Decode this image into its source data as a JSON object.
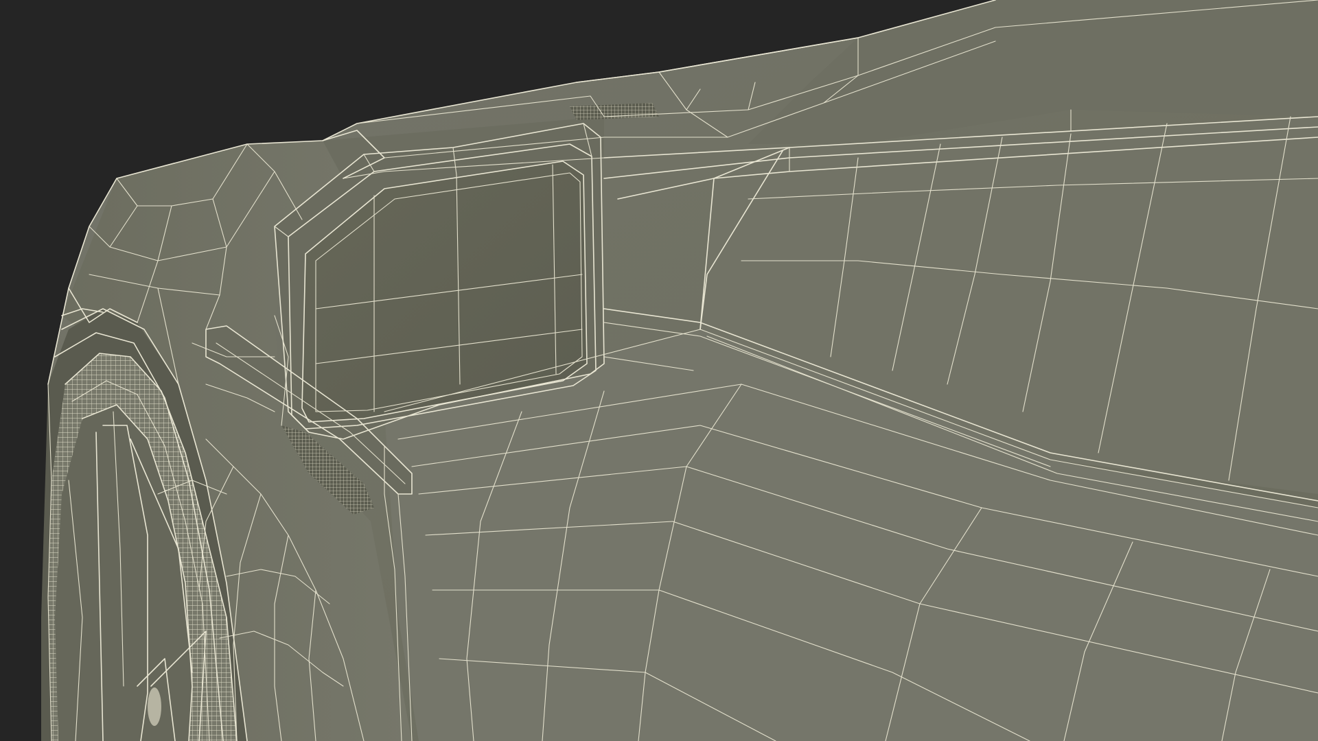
{
  "scene": {
    "subject": "car-side-mirror-wireframe",
    "colors": {
      "background": "#252525",
      "surface": "#6f7061",
      "surface_light": "#7b7c6c",
      "surface_dark": "#5f6053",
      "wire": "#e9e6d3"
    }
  }
}
